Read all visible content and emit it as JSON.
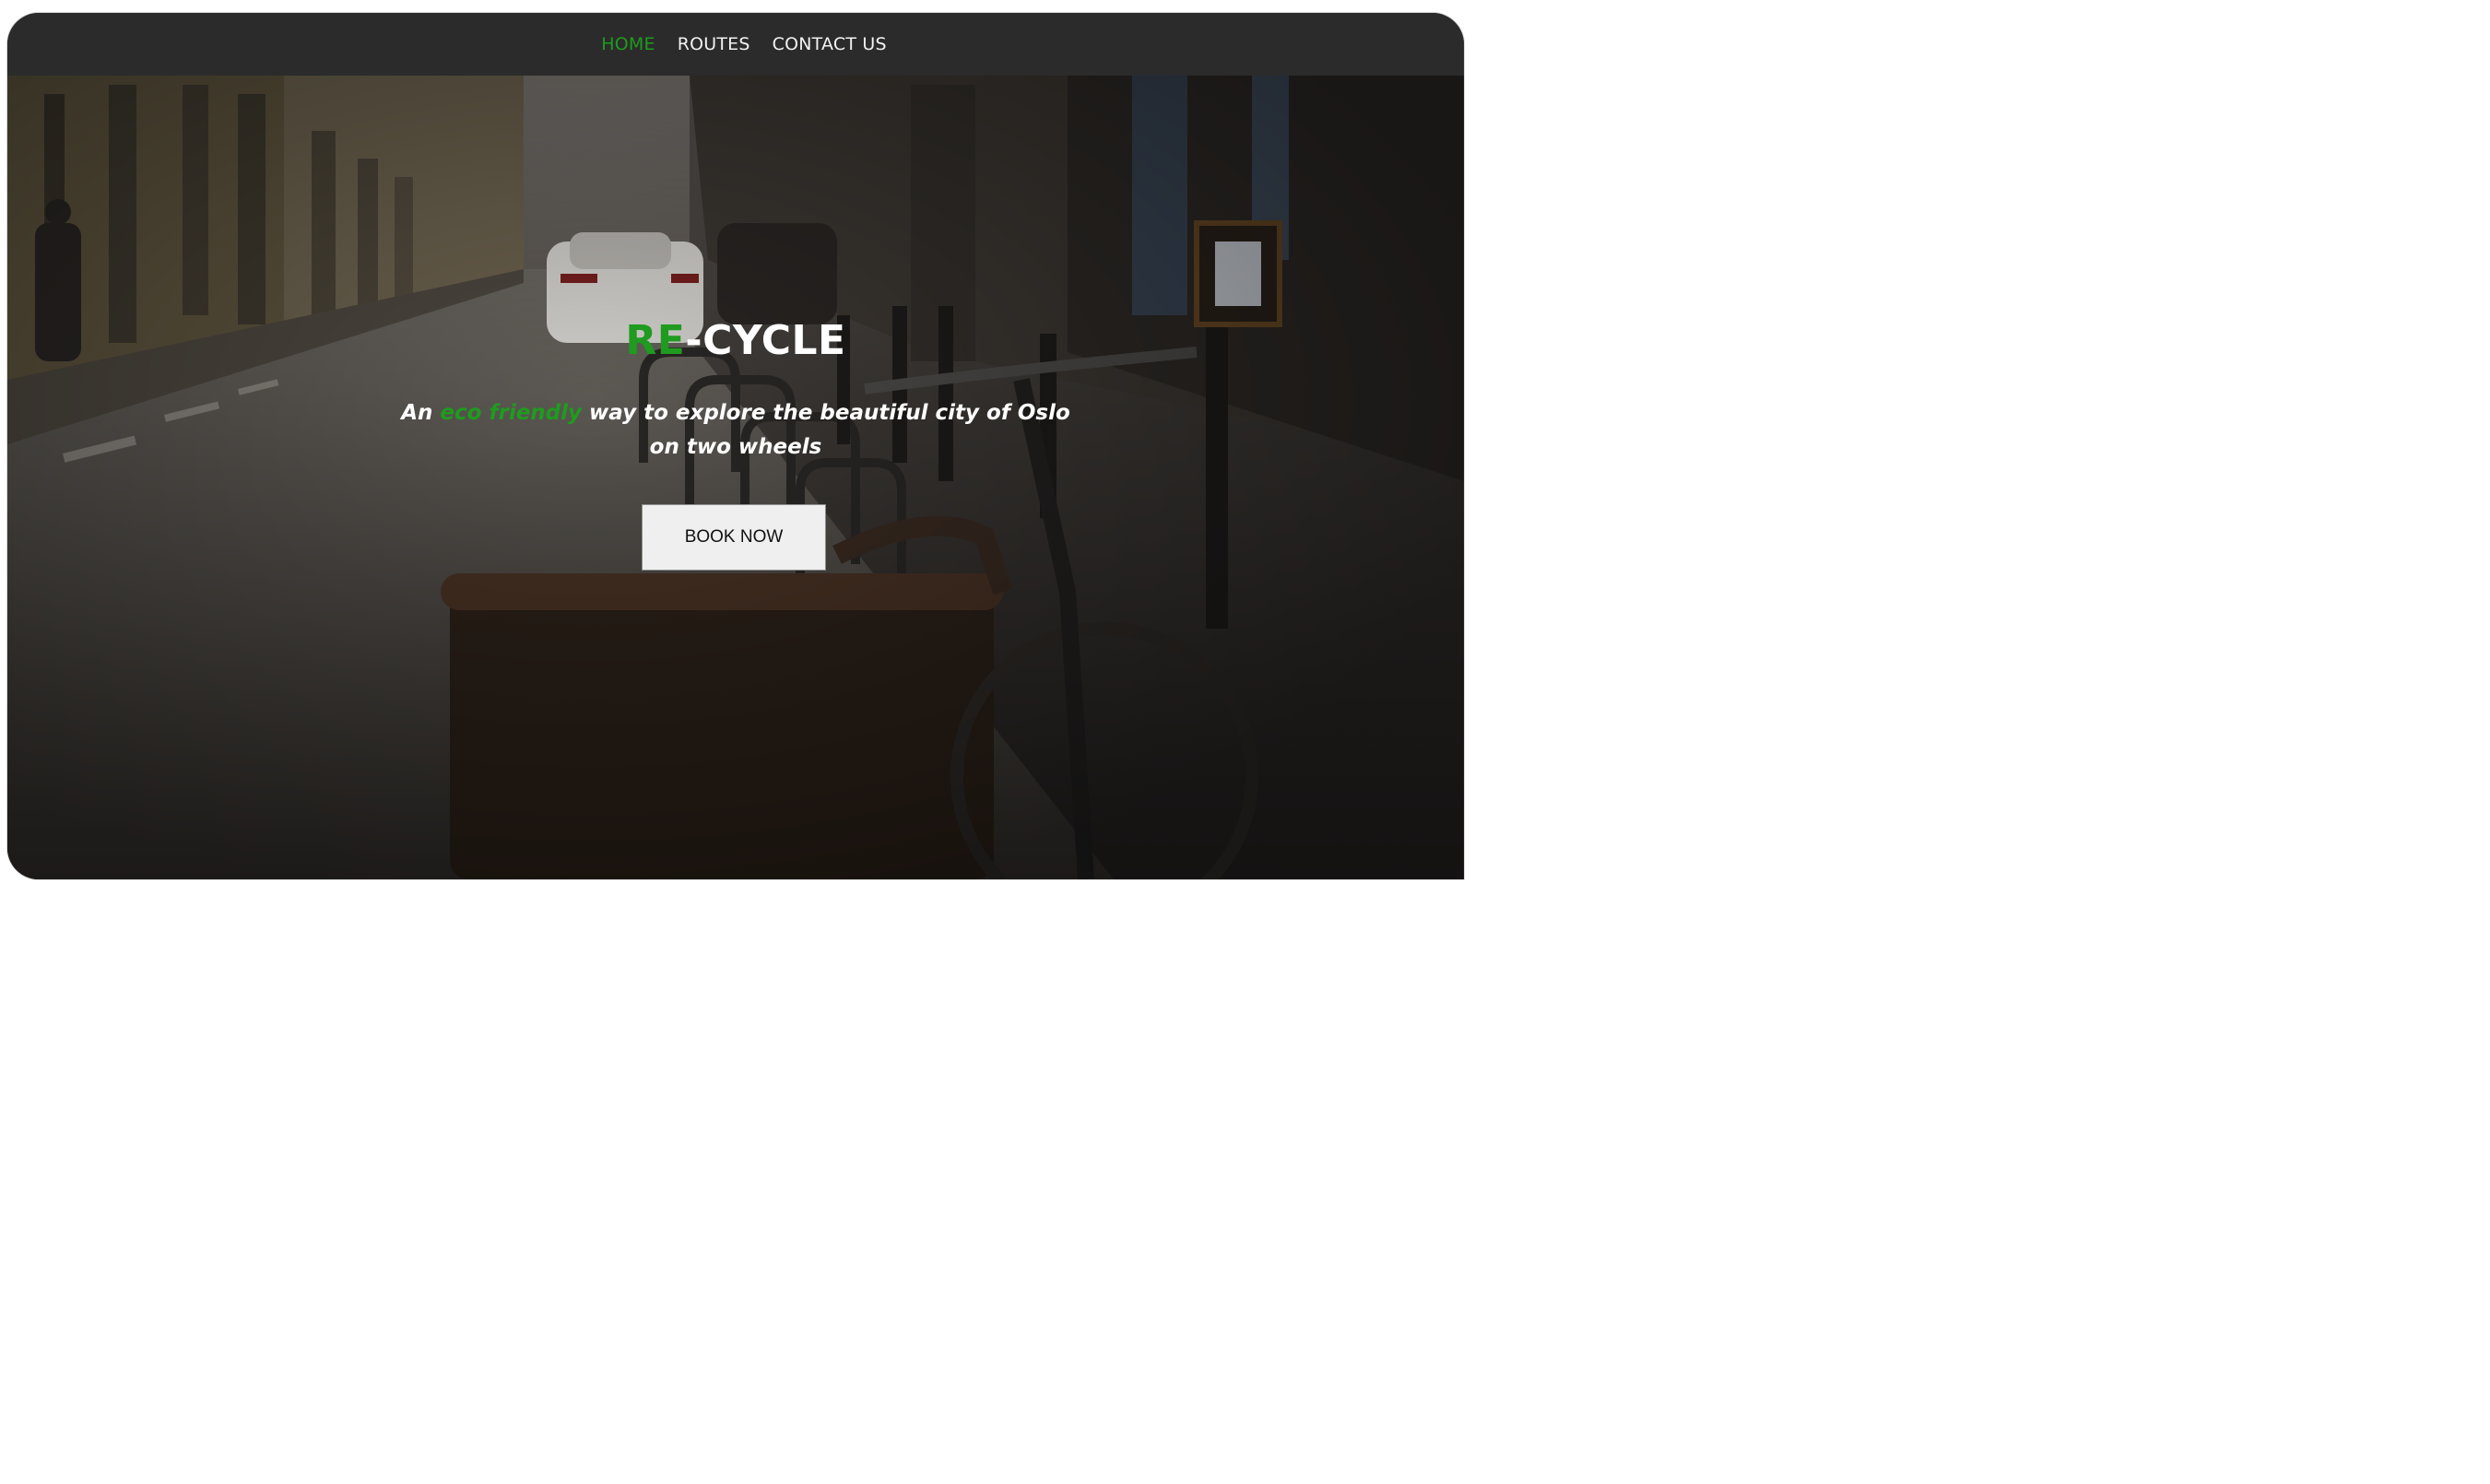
{
  "nav": {
    "items": [
      {
        "label": "HOME",
        "active": true
      },
      {
        "label": "ROUTES",
        "active": false
      },
      {
        "label": "CONTACT US",
        "active": false
      }
    ]
  },
  "hero": {
    "brand_prefix": "RE",
    "brand_suffix": "-CYCLE",
    "tagline_start": "An ",
    "tagline_highlight": "eco friendly",
    "tagline_end": " way to explore the beautiful city of Oslo on two wheels",
    "button_label": "BOOK NOW"
  },
  "colors": {
    "accent": "#1f9b1f",
    "navbar": "#2b2b2b",
    "text": "#ffffff",
    "button_bg": "#efefef"
  }
}
